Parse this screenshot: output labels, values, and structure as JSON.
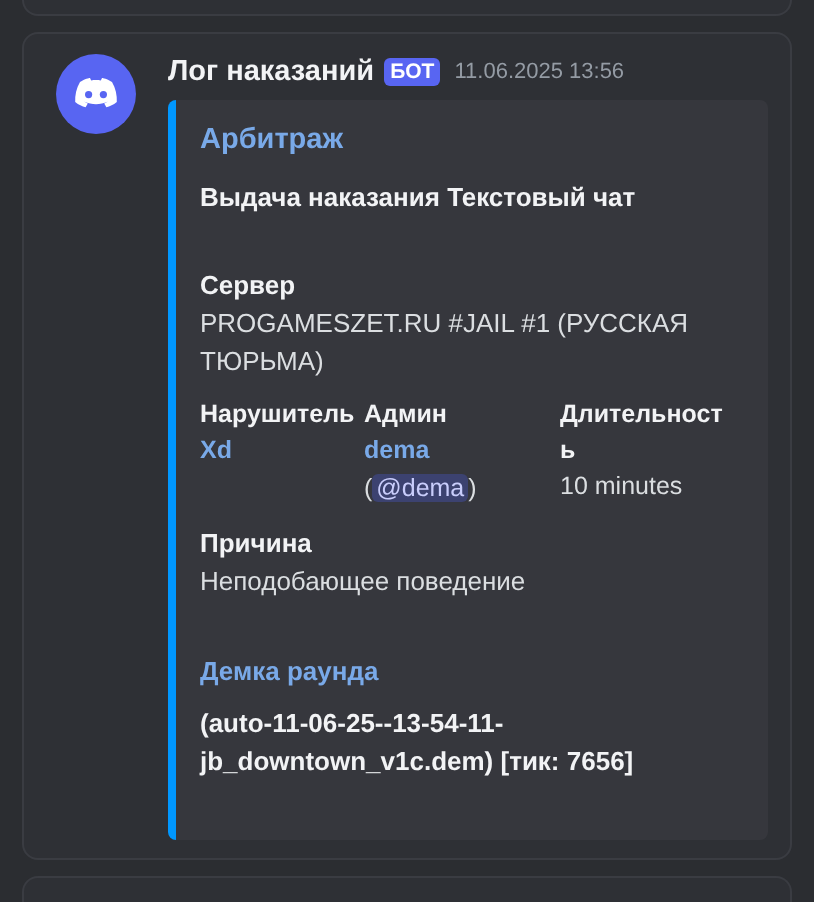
{
  "message": {
    "author": "Лог наказаний",
    "badge": "БОТ",
    "timestamp": "11.06.2025 13:56"
  },
  "embed": {
    "title": "Арбитраж",
    "description": "Выдача наказания Текстовый чат",
    "fields": [
      {
        "kind": "plain",
        "inline": false,
        "name": "Сервер",
        "lines": [
          [
            {
              "kind": "text",
              "text": "PROGAMESZET.RU #JAIL #1 (РУССКАЯ ТЮРЬМА)"
            }
          ]
        ]
      },
      {
        "kind": "plain",
        "inline": true,
        "name": "Нарушитель",
        "lines": [
          [
            {
              "kind": "link",
              "text": "Xd"
            }
          ]
        ]
      },
      {
        "kind": "plain",
        "inline": true,
        "name": "Админ",
        "lines": [
          [
            {
              "kind": "link",
              "text": "dema"
            }
          ],
          [
            {
              "kind": "text",
              "text": "("
            },
            {
              "kind": "mention",
              "text": "@dema"
            },
            {
              "kind": "text",
              "text": ")"
            }
          ]
        ]
      },
      {
        "kind": "plain",
        "inline": true,
        "name": "Длительность",
        "lines": [
          [
            {
              "kind": "text",
              "text": "10 minutes"
            }
          ]
        ]
      },
      {
        "kind": "plain",
        "inline": false,
        "name": "Причина",
        "lines": [
          [
            {
              "kind": "text",
              "text": "Неподобающее поведение"
            }
          ]
        ]
      },
      {
        "kind": "link",
        "inline": false,
        "name": "Демка раунда",
        "lines": [
          [
            {
              "kind": "strong",
              "text": "(auto-11-06-25--13-54-11-jb_downtown_v1c.dem) [тик: 7656]"
            }
          ]
        ]
      }
    ]
  }
}
